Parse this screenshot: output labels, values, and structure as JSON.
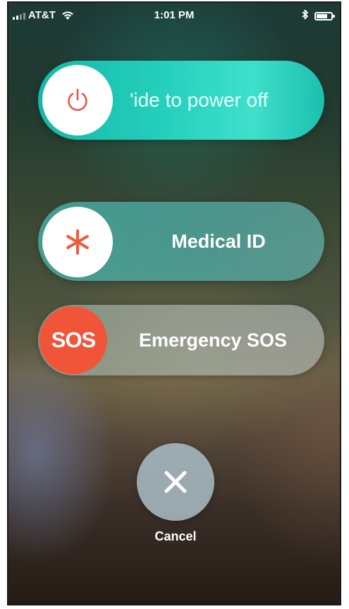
{
  "status_bar": {
    "carrier": "AT&T",
    "time": "1:01 PM",
    "wifi_icon": "wifi-icon",
    "bluetooth_icon": "bluetooth-icon",
    "battery_icon": "battery-icon"
  },
  "power_slider": {
    "label": "'ide to power off",
    "icon": "power-icon",
    "knob_icon_color": "#e8584a",
    "track_color": "#25d0bd"
  },
  "medical_slider": {
    "label": "Medical ID",
    "icon": "asterisk-icon",
    "icon_color": "#f05a3c"
  },
  "sos_slider": {
    "badge": "SOS",
    "label": "Emergency SOS",
    "badge_color": "#f0553a"
  },
  "cancel": {
    "label": "Cancel",
    "icon": "close-icon"
  }
}
